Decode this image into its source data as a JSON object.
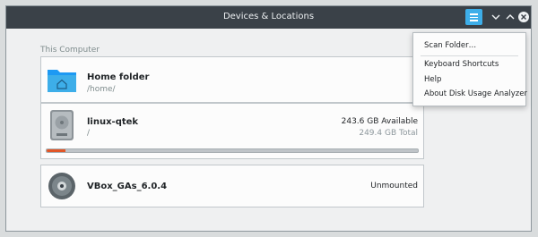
{
  "window": {
    "title": "Devices & Locations"
  },
  "titlebar": {
    "menu_icon": "hamburger-menu-icon",
    "minimize_icon": "chevron-down-icon",
    "maximize_icon": "chevron-up-icon",
    "close_icon": "close-circle-icon"
  },
  "section": {
    "label": "This Computer"
  },
  "devices": [
    {
      "name": "Home folder",
      "path": "/home/",
      "icon": "folder-home-icon"
    },
    {
      "name": "linux-qtek",
      "path": "/",
      "available": "243.6 GB Available",
      "total": "249.4 GB Total",
      "usage_fraction": 0.05,
      "icon": "hard-drive-icon"
    },
    {
      "name": "VBox_GAs_6.0.4",
      "status": "Unmounted",
      "icon": "optical-disc-icon"
    }
  ],
  "menu": {
    "items": [
      "Scan Folder…",
      "Keyboard Shortcuts",
      "Help",
      "About Disk Usage Analyzer"
    ]
  },
  "colors": {
    "accent": "#3daee9",
    "usage_bar": "#e15627",
    "titlebar": "#3a4148"
  }
}
